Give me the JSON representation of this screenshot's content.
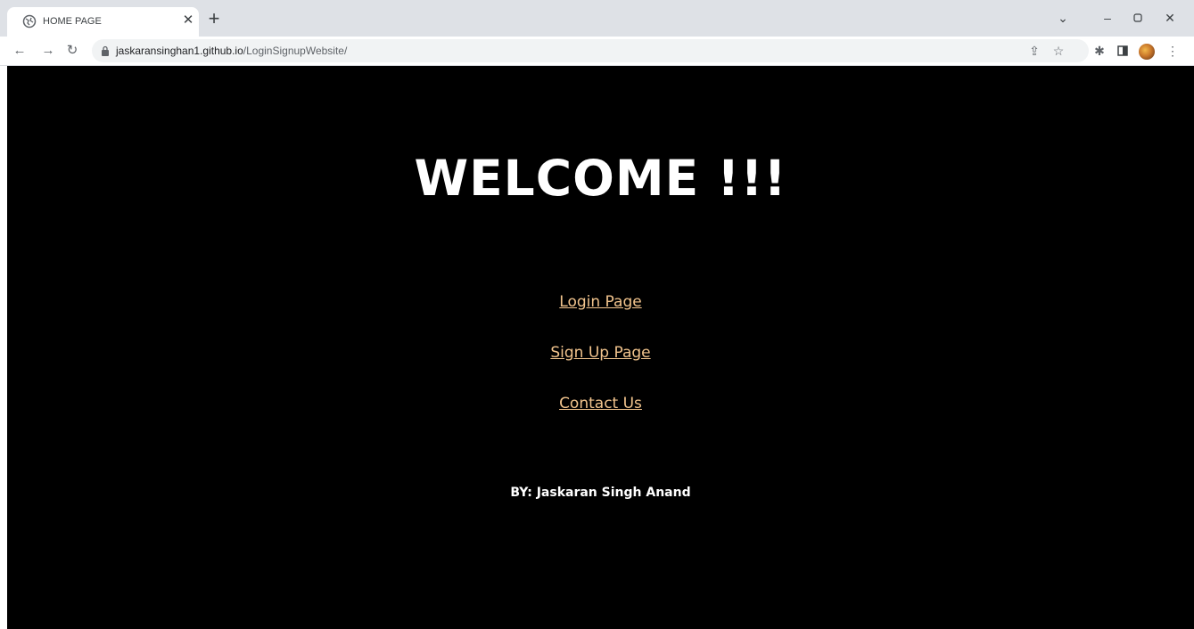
{
  "browser": {
    "tab": {
      "title": "HOME PAGE",
      "favicon": "globe-icon"
    },
    "url": {
      "host": "jaskaransinghan1.github.io",
      "path": "/LoginSignupWebsite/"
    }
  },
  "page": {
    "heading": "WELCOME !!!",
    "links": {
      "login": "Login Page",
      "signup": "Sign Up Page",
      "contact": "Contact Us"
    },
    "byline": "BY: Jaskaran Singh Anand"
  },
  "colors": {
    "page_background": "#000000",
    "link": "#f2c48d",
    "text": "#ffffff",
    "tabstrip": "#dee1e6"
  }
}
